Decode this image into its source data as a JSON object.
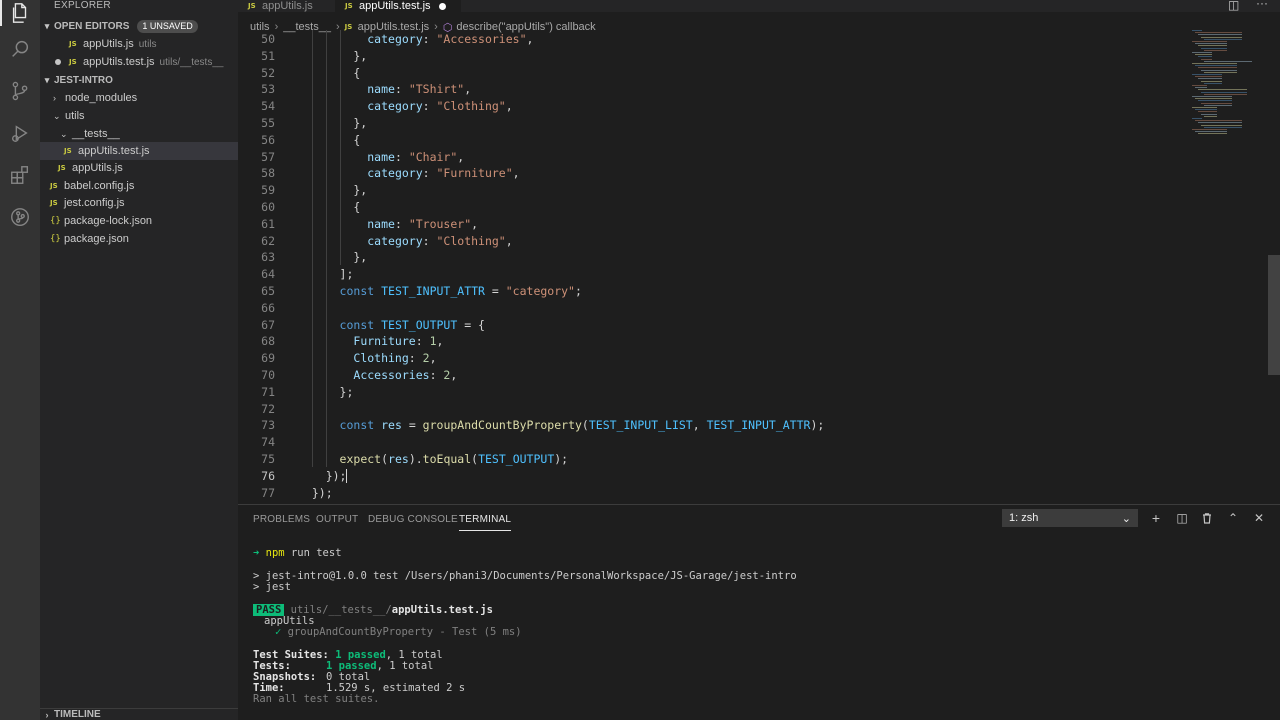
{
  "sidebar": {
    "title": "EXPLORER",
    "open_editors": {
      "label": "OPEN EDITORS",
      "badge": "1 UNSAVED",
      "items": [
        {
          "name": "appUtils.js",
          "desc": "utils"
        },
        {
          "name": "appUtils.test.js",
          "desc": "utils/__tests__"
        }
      ]
    },
    "project": {
      "label": "JEST-INTRO",
      "items": [
        {
          "name": "node_modules"
        },
        {
          "name": "utils"
        },
        {
          "name": "__tests__"
        },
        {
          "name": "appUtils.test.js"
        },
        {
          "name": "appUtils.js"
        },
        {
          "name": "babel.config.js"
        },
        {
          "name": "jest.config.js"
        },
        {
          "name": "package-lock.json"
        },
        {
          "name": "package.json"
        }
      ]
    },
    "timeline": "TIMELINE"
  },
  "tabs": [
    {
      "label": "appUtils.js",
      "icon": "JS"
    },
    {
      "label": "appUtils.test.js",
      "icon": "JS"
    }
  ],
  "breadcrumb": [
    "utils",
    "__tests__",
    "appUtils.test.js",
    "describe(\"appUtils\") callback"
  ],
  "code": {
    "line_numbers": [
      "50",
      "51",
      "52",
      "53",
      "54",
      "55",
      "56",
      "57",
      "58",
      "59",
      "60",
      "61",
      "62",
      "63",
      "64",
      "65",
      "66",
      "67",
      "68",
      "69",
      "70",
      "71",
      "72",
      "73",
      "74",
      "75",
      "76",
      "77"
    ],
    "lines": [
      "          category: \"Accessories\",",
      "        },",
      "        {",
      "          name: \"TShirt\",",
      "          category: \"Clothing\",",
      "        },",
      "        {",
      "          name: \"Chair\",",
      "          category: \"Furniture\",",
      "        },",
      "        {",
      "          name: \"Trouser\",",
      "          category: \"Clothing\",",
      "        },",
      "      ];",
      "      const TEST_INPUT_ATTR = \"category\";",
      "",
      "      const TEST_OUTPUT = {",
      "        Furniture: 1,",
      "        Clothing: 2,",
      "        Accessories: 2,",
      "      };",
      "",
      "      const res = groupAndCountByProperty(TEST_INPUT_LIST, TEST_INPUT_ATTR);",
      "",
      "      expect(res).toEqual(TEST_OUTPUT);",
      "    });",
      "  });"
    ]
  },
  "panel": {
    "tabs": [
      "PROBLEMS",
      "OUTPUT",
      "DEBUG CONSOLE",
      "TERMINAL"
    ],
    "active_tab": "TERMINAL",
    "terminal_select": "1: zsh",
    "terminal": {
      "prompt_arrow": "➜",
      "cmd_npm": "npm",
      "cmd_rest": " run test",
      "line_script": "> jest-intro@1.0.0 test /Users/phani3/Documents/PersonalWorkspace/JS-Garage/jest-intro",
      "line_jest": "> jest",
      "pass_badge": "PASS",
      "pass_path_dim": "utils/__tests__/",
      "pass_file": "appUtils.test.js",
      "suite": "appUtils",
      "check": "✓",
      "test_name": "groupAndCountByProperty - Test (5 ms)",
      "suites_label": "Test Suites:",
      "suites_passed": "1 passed",
      "suites_total": ", 1 total",
      "tests_label": "Tests:",
      "tests_passed": "1 passed",
      "tests_total": ", 1 total",
      "snapshots_label": "Snapshots:",
      "snapshots_value": "0 total",
      "time_label": "Time:",
      "time_value": "1.529 s, estimated 2 s",
      "ran_all": "Ran all test suites."
    }
  },
  "colors": {
    "activity_bar": "#333333",
    "sidebar": "#252526",
    "editor": "#1e1e1e",
    "keyword": "#569cd6",
    "string": "#ce9178",
    "pass": "#0dbc79"
  }
}
